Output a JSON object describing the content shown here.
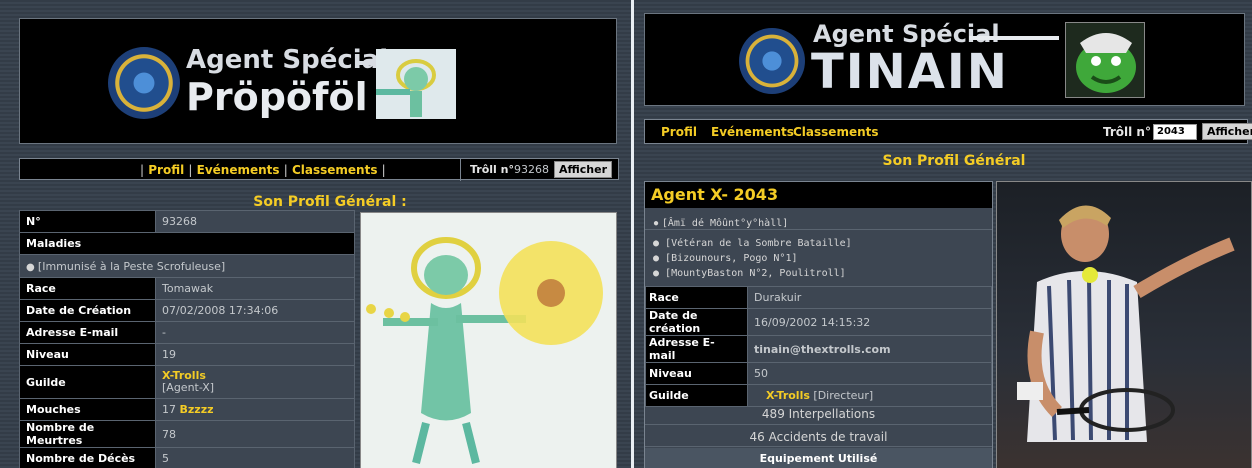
{
  "left": {
    "banner": {
      "title": "Agent Spécial",
      "name": "Pröpöföl"
    },
    "nav": {
      "profil": "Profil",
      "evenements": "Evénements",
      "classements": "Classements",
      "troll_label": "Trôll n°",
      "troll_value": "93268",
      "afficher": "Afficher"
    },
    "section_title": "Son Profil Général :",
    "rows": {
      "num_k": "N°",
      "num_v": "93268",
      "maladies_k": "Maladies",
      "maladie_item": "[Immunisé à la Peste Scrofuleuse]",
      "race_k": "Race",
      "race_v": "Tomawak",
      "creation_k": "Date de Création",
      "creation_v": "07/02/2008 17:34:06",
      "email_k": "Adresse E-mail",
      "email_v": "-",
      "niveau_k": "Niveau",
      "niveau_v": "19",
      "guilde_k": "Guilde",
      "guilde_link": "X-Trolls",
      "guilde_rank": "[Agent-X]",
      "mouches_k": "Mouches",
      "mouches_num": "17",
      "mouches_link": "Bzzzz",
      "meurtres_k": "Nombre de Meurtres",
      "meurtres_v": "78",
      "deces_k": "Nombre de Décès",
      "deces_v": "5"
    }
  },
  "right": {
    "banner": {
      "title": "Agent Spécial",
      "name": "TINAIN"
    },
    "nav": {
      "profil": "Profil",
      "evenements": "Evénements",
      "classements": "Classements",
      "troll_label": "Trôll n° :",
      "troll_value": "2043",
      "afficher": "Afficher"
    },
    "section_title": "Son Profil Général",
    "agent_title": "Agent X- 2043",
    "titles": [
      "[Âmï dé Môûnt°y°hàll]"
    ],
    "honors": [
      "[Vétéran de la Sombre Bataille]",
      "[Bizounours, Pogo N°1]",
      "[MountyBaston N°2, Poulitroll]"
    ],
    "rows": {
      "race_k": "Race",
      "race_v": "Durakuir",
      "creation_k": "Date de création",
      "creation_v": "16/09/2002 14:15:32",
      "email_k": "Adresse E-mail",
      "email_v": "tinain@thextrolls.com",
      "niveau_k": "Niveau",
      "niveau_v": "50",
      "guilde_k": "Guilde",
      "guilde_link": "X-Trolls",
      "guilde_rank": "[Directeur]"
    },
    "stats": {
      "interpellations": "489 Interpellations",
      "accidents": "46 Accidents de travail"
    },
    "equipment_label": "Equipement Utilisé"
  }
}
